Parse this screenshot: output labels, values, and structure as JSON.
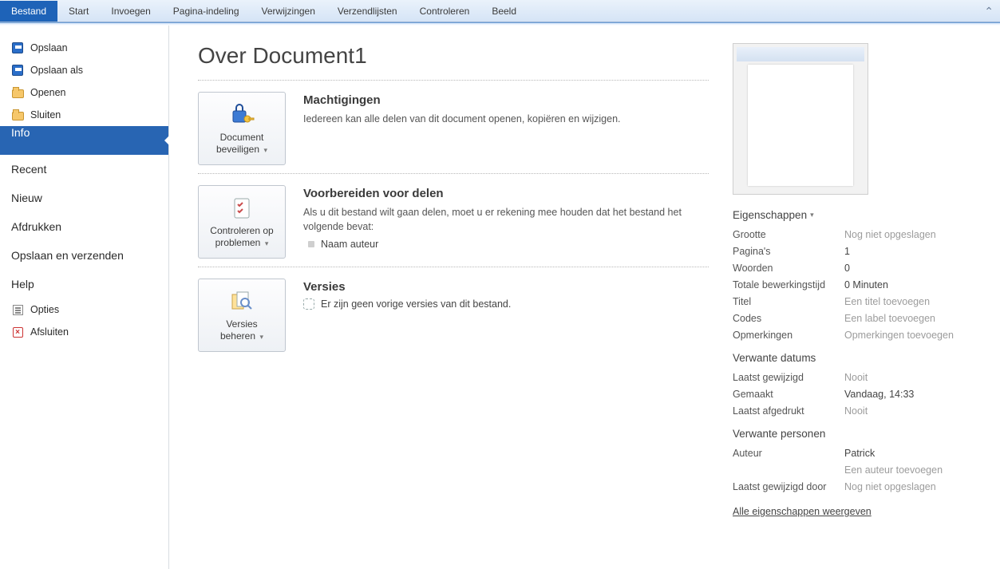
{
  "ribbon": {
    "tabs": [
      "Bestand",
      "Start",
      "Invoegen",
      "Pagina-indeling",
      "Verwijzingen",
      "Verzendlijsten",
      "Controleren",
      "Beeld"
    ],
    "active": 0
  },
  "sidebar": {
    "save": "Opslaan",
    "saveas": "Opslaan als",
    "open": "Openen",
    "close": "Sluiten",
    "info": "Info",
    "recent": "Recent",
    "new": "Nieuw",
    "print": "Afdrukken",
    "saveandsend": "Opslaan en verzenden",
    "help": "Help",
    "options": "Opties",
    "exit": "Afsluiten"
  },
  "main": {
    "title": "Over Document1",
    "protect": {
      "button_l1": "Document",
      "button_l2": "beveiligen",
      "heading": "Machtigingen",
      "text": "Iedereen kan alle delen van dit document openen, kopiëren en wijzigen."
    },
    "prepare": {
      "button_l1": "Controleren op",
      "button_l2": "problemen",
      "heading": "Voorbereiden voor delen",
      "text": "Als u dit bestand wilt gaan delen, moet u er rekening mee houden dat het bestand het volgende bevat:",
      "bullet1": "Naam auteur"
    },
    "versions": {
      "button_l1": "Versies",
      "button_l2": "beheren",
      "heading": "Versies",
      "text": "Er zijn geen vorige versies van dit bestand."
    }
  },
  "props": {
    "heading": "Eigenschappen",
    "size_l": "Grootte",
    "size_v": "Nog niet opgeslagen",
    "pages_l": "Pagina's",
    "pages_v": "1",
    "words_l": "Woorden",
    "words_v": "0",
    "edit_l": "Totale bewerkingstijd",
    "edit_v": "0 Minuten",
    "title_l": "Titel",
    "title_v": "Een titel toevoegen",
    "tags_l": "Codes",
    "tags_v": "Een label toevoegen",
    "comments_l": "Opmerkingen",
    "comments_v": "Opmerkingen toevoegen",
    "dates_h": "Verwante datums",
    "mod_l": "Laatst gewijzigd",
    "mod_v": "Nooit",
    "created_l": "Gemaakt",
    "created_v": "Vandaag, 14:33",
    "printed_l": "Laatst afgedrukt",
    "printed_v": "Nooit",
    "people_h": "Verwante personen",
    "author_l": "Auteur",
    "author_v": "Patrick",
    "addauthor": "Een auteur toevoegen",
    "lastby_l": "Laatst gewijzigd door",
    "lastby_v": "Nog niet opgeslagen",
    "showall": "Alle eigenschappen weergeven"
  }
}
